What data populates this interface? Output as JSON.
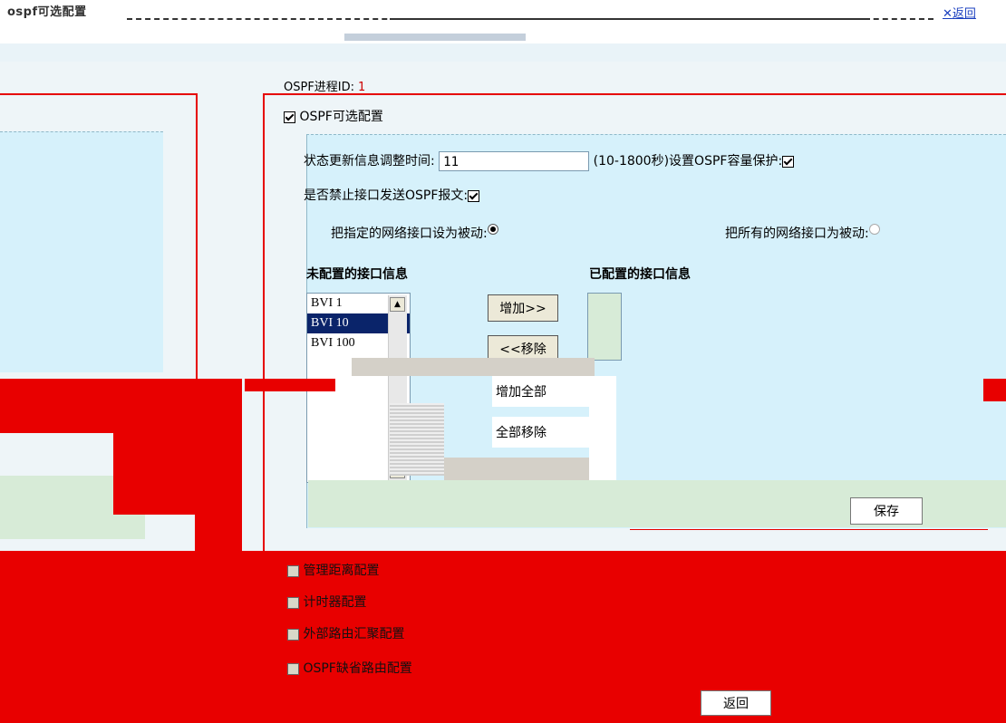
{
  "header": {
    "title": "ospf可选配置",
    "back_link": "返回"
  },
  "process": {
    "label": "OSPF进程ID:",
    "value": "1"
  },
  "optional": {
    "heading": "OSPF可选配置",
    "update_time_label": "状态更新信息调整时间:",
    "update_time_value": "11",
    "update_time_hint": "(10-1800秒)",
    "capacity_label": "设置OSPF容量保护:",
    "disable_send_label": "是否禁止接口发送OSPF报文:",
    "radio_specified": "把指定的网络接口设为被动:",
    "radio_all": "把所有的网络接口为被动:",
    "unconfigured_heading": "未配置的接口信息",
    "configured_heading": "已配置的接口信息",
    "interfaces": [
      "BVI 1",
      "BVI 10",
      "BVI 100"
    ],
    "buttons": {
      "add": "增加>>",
      "remove": "<<移除",
      "add_all": "增加全部",
      "remove_all": "全部移除",
      "save": "保存"
    }
  },
  "sections": [
    {
      "label": "管理距离配置"
    },
    {
      "label": "计时器配置"
    },
    {
      "label": "外部路由汇聚配置"
    },
    {
      "label": "OSPF缺省路由配置"
    }
  ],
  "footer": {
    "back_button": "返回"
  },
  "colors": {
    "accent_red": "#e80000",
    "panel_blue": "#d6f1fb",
    "panel_green": "#d7ebd7",
    "link_blue": "#1a3fbf"
  }
}
